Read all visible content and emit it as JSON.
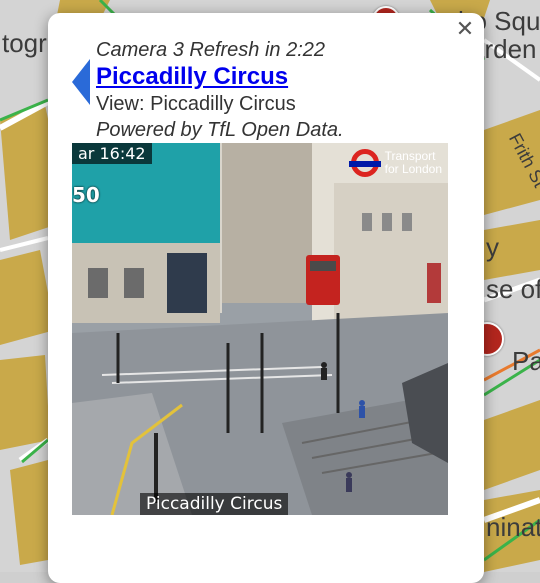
{
  "map": {
    "labels": [
      {
        "text": "togr"
      },
      {
        "text": "ho Squ"
      },
      {
        "text": "arden"
      },
      {
        "text": "Frith St"
      },
      {
        "text": "y"
      },
      {
        "text": "se of"
      },
      {
        "text": "Pa"
      },
      {
        "text": "ninat"
      }
    ]
  },
  "popup": {
    "refresh_line": "Camera 3 Refresh in 2:22",
    "title": "Piccadilly Circus",
    "view_line": "View: Piccadilly Circus",
    "credit_line": "Powered by TfL Open Data.",
    "close_symbol": "✕"
  },
  "camera": {
    "timestamp": "ar 16:42",
    "number": "50",
    "caption": "Piccadilly Circus",
    "logo_line1": "Transport",
    "logo_line2": "for London"
  }
}
